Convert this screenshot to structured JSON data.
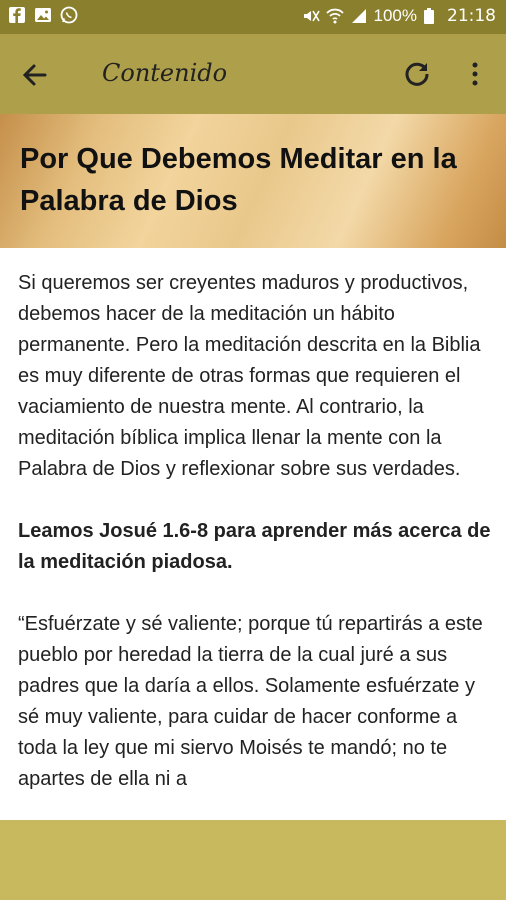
{
  "status_bar": {
    "battery": "100%",
    "time": "21:18",
    "icons": [
      "facebook-icon",
      "image-icon",
      "whatsapp-icon",
      "mute-icon",
      "wifi-icon",
      "signal-icon",
      "battery-icon"
    ]
  },
  "toolbar": {
    "title": "Contenido",
    "icons": [
      "back-arrow-icon",
      "refresh-icon",
      "more-vert-icon"
    ]
  },
  "article": {
    "title": "Por Que Debemos Meditar en la Palabra de Dios",
    "paragraphs": [
      "Si queremos ser creyentes maduros y productivos, debemos hacer de la meditación un hábito permanente. Pero la meditación descrita en la Biblia es muy diferente de otras formas que requieren el vaciamiento de nuestra mente. Al contrario, la meditación bíblica implica llenar la mente con la Palabra de Dios y reflexionar sobre sus verdades.",
      "Leamos Josué 1.6-8 para aprender más acerca de la meditación piadosa.",
      "“Esfuérzate y sé valiente; porque tú repartirás a este pueblo por heredad la tierra de la cual juré a sus padres que la daría a ellos. Solamente esfuérzate y sé muy valiente, para cuidar de hacer conforme a toda la ley que mi siervo Moisés te mandó; no te apartes de ella ni a"
    ]
  },
  "colors": {
    "status_bar": "#8a7f2c",
    "toolbar": "#ae9f4a",
    "bottom_bar": "#c8b95f"
  }
}
